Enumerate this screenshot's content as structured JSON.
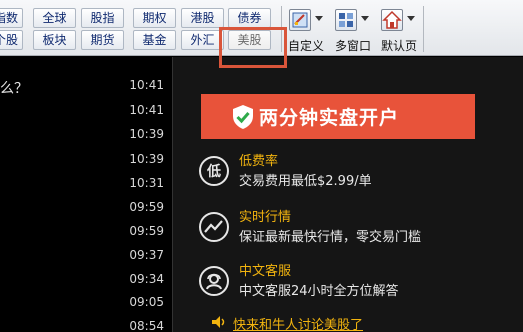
{
  "toolbar": {
    "row1": [
      "指数",
      "全球",
      "股指",
      "期权",
      "港股",
      "债券"
    ],
    "row2": [
      "个股",
      "板块",
      "期货",
      "基金",
      "外汇",
      "美股"
    ],
    "tools": [
      {
        "icon": "custom-layout-icon",
        "label": "自定义"
      },
      {
        "icon": "multi-window-icon",
        "label": "多窗口"
      },
      {
        "icon": "home-icon",
        "label": "默认页"
      }
    ],
    "highlight_color": "#d9553a"
  },
  "news": {
    "partial_title": "么？",
    "times": [
      "10:41",
      "10:41",
      "10:39",
      "10:39",
      "10:31",
      "09:59",
      "09:59",
      "09:37",
      "09:34",
      "09:05",
      "08:54"
    ]
  },
  "promo": {
    "open_button": "两分钟实盘开户",
    "button_color": "#e8533a",
    "features": [
      {
        "icon": "low-fee-icon",
        "glyph": "低",
        "title": "低费率",
        "desc": "交易费用最低$2.99/单"
      },
      {
        "icon": "realtime-chart-icon",
        "title": "实时行情",
        "desc": "保证最新最快行情，零交易门槛"
      },
      {
        "icon": "chinese-service-icon",
        "title": "中文客服",
        "desc": "中文客服24小时全方位解答"
      }
    ],
    "talk_link": "快来和牛人讨论美股了",
    "accent_color": "#f2b40f"
  }
}
